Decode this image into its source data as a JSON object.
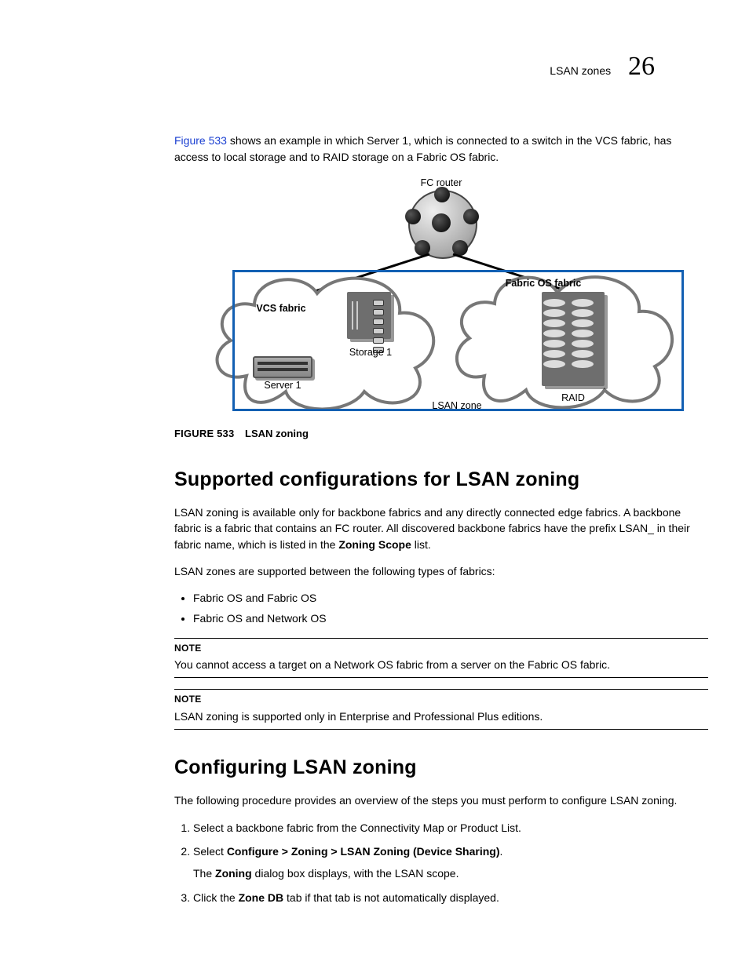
{
  "header": {
    "section_title": "LSAN zones",
    "chapter_number": "26"
  },
  "intro": {
    "link_text": "Figure 533",
    "rest": " shows an example in which Server 1, which is connected to a switch in the VCS fabric, has access to local storage and to RAID storage on a Fabric OS fabric."
  },
  "diagram": {
    "fc_router": "FC router",
    "vcs_fabric_label": "VCS fabric",
    "fabric_os_label": "Fabric OS fabric",
    "server1": "Server 1",
    "storage1": "Storage 1",
    "raid": "RAID",
    "lsan_zone": "LSAN zone"
  },
  "figure_caption": {
    "prefix": "FIGURE 533",
    "title": "LSAN zoning"
  },
  "section1": {
    "heading": "Supported configurations for LSAN zoning",
    "para1a": "LSAN zoning is available only for backbone fabrics and any directly connected edge fabrics. A backbone fabric is a fabric that contains an FC router. All discovered backbone fabrics have the prefix LSAN_ in their fabric name, which is listed in the ",
    "para1_bold": "Zoning Scope",
    "para1b": " list.",
    "para2": "LSAN zones are supported between the following types of fabrics:",
    "bullets": [
      "Fabric OS and Fabric OS",
      "Fabric OS and Network OS"
    ],
    "note1_label": "NOTE",
    "note1_text": "You cannot access a target on a Network OS fabric from a server on the Fabric OS fabric.",
    "note2_label": "NOTE",
    "note2_text": "LSAN zoning is supported only in Enterprise and Professional Plus editions."
  },
  "section2": {
    "heading": "Configuring LSAN zoning",
    "intro": "The following procedure provides an overview of the steps you must perform to configure LSAN zoning.",
    "step1": "Select a backbone fabric from the Connectivity Map or Product List.",
    "step2a": "Select ",
    "step2_bold": "Configure > Zoning > LSAN Zoning (Device Sharing)",
    "step2b": ".",
    "step2_sub_a": "The ",
    "step2_sub_bold": "Zoning",
    "step2_sub_b": " dialog box displays, with the LSAN scope.",
    "step3a": "Click the ",
    "step3_bold": "Zone DB",
    "step3b": " tab if that tab is not automatically displayed."
  }
}
